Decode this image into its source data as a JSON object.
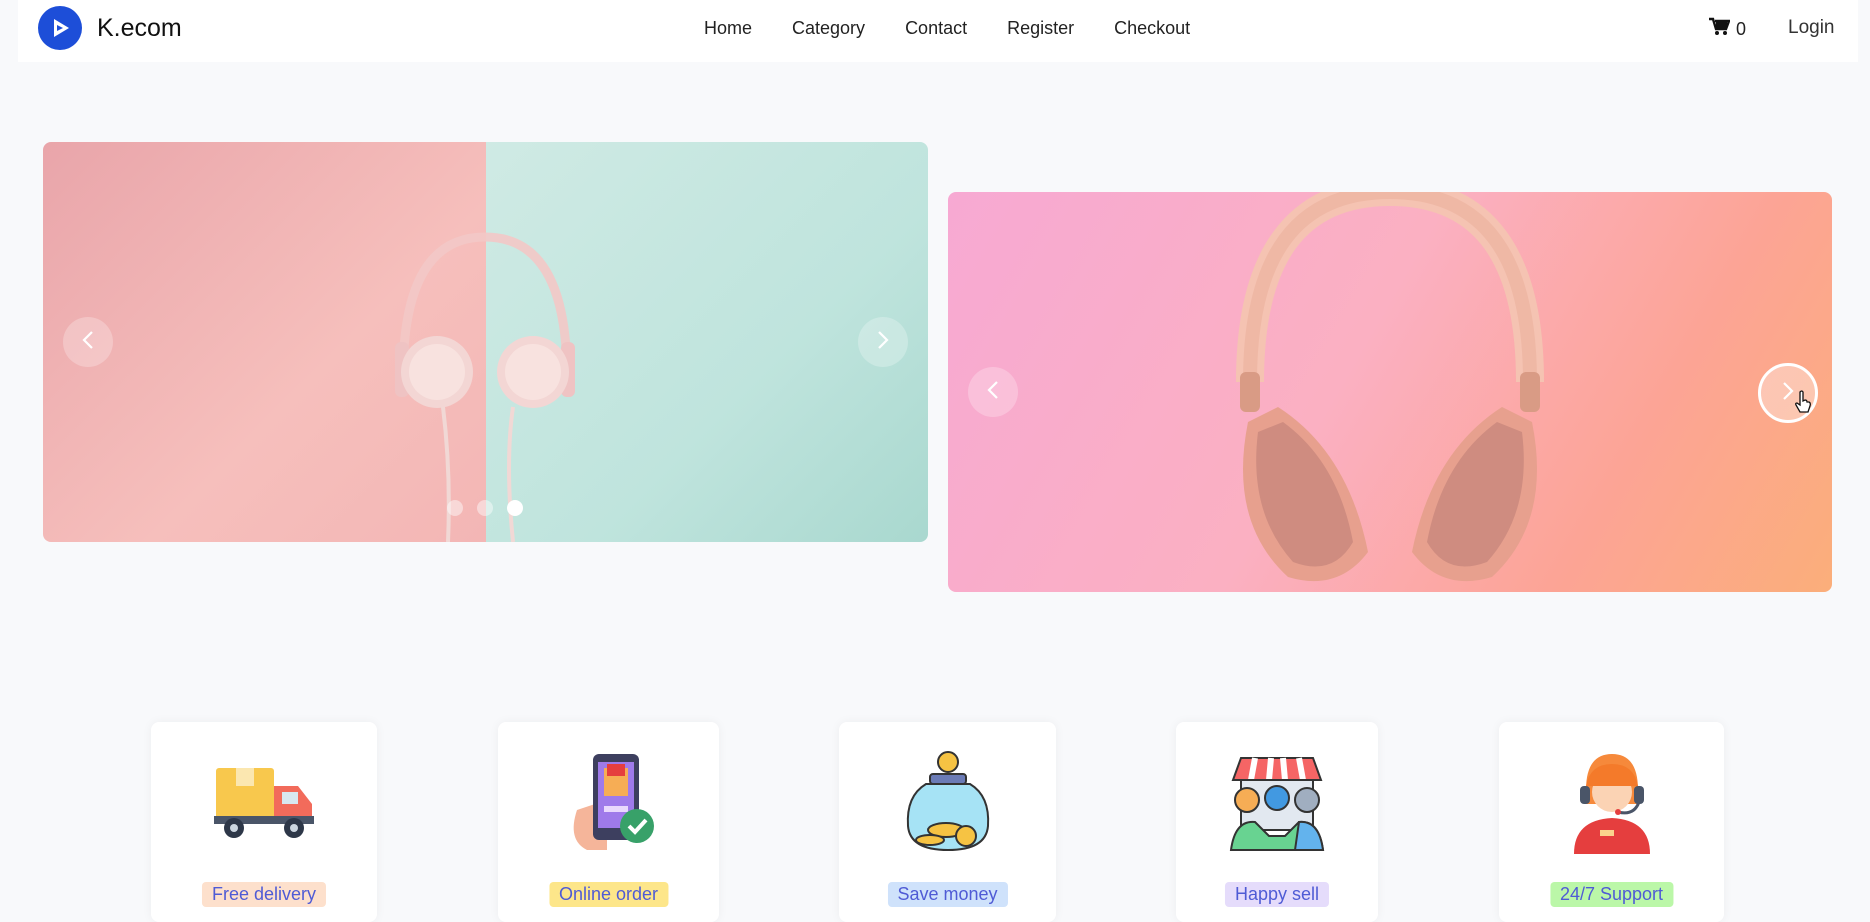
{
  "brand": {
    "name": "K.ecom",
    "logo_icon": "play-logo-icon",
    "logo_color": "#1d4ed8"
  },
  "nav": {
    "links": [
      "Home",
      "Category",
      "Contact",
      "Register",
      "Checkout"
    ],
    "cart_count": "0",
    "cart_icon": "cart-icon",
    "login": "Login"
  },
  "carousel_left": {
    "image": "pink-white-headphones-on-pink-teal-background",
    "active_dot": 3,
    "dot_count": 3
  },
  "carousel_right": {
    "image": "pink-over-ear-headphones-on-pink-orange-background"
  },
  "features": [
    {
      "label": "Free delivery",
      "icon": "delivery-truck-icon",
      "badge_color": "#fde0cc"
    },
    {
      "label": "Online order",
      "icon": "phone-order-icon",
      "badge_color": "#fde68a"
    },
    {
      "label": "Save money",
      "icon": "money-jar-icon",
      "badge_color": "#cfe2fb"
    },
    {
      "label": "Happy sell",
      "icon": "shop-icon",
      "badge_color": "#e5dcfb"
    },
    {
      "label": "24/7 Support",
      "icon": "support-agent-icon",
      "badge_color": "#bbf7a8"
    }
  ]
}
